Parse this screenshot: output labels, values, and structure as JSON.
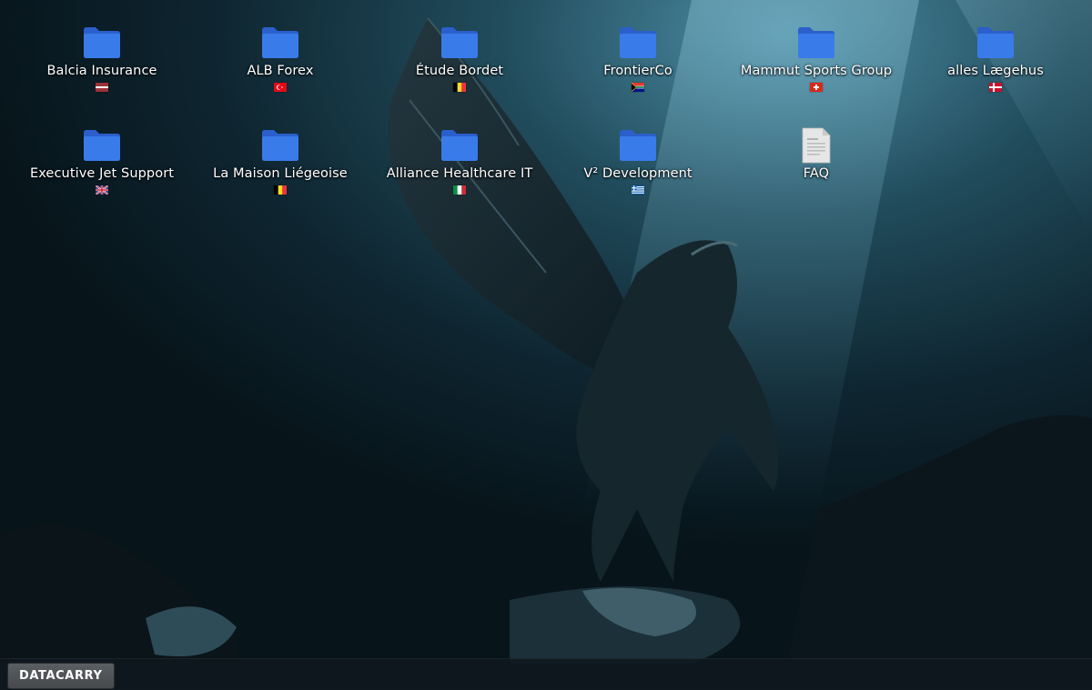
{
  "desktop": {
    "icons": [
      {
        "label": "Balcia Insurance",
        "type": "folder",
        "flag": "latvia-flag-icon"
      },
      {
        "label": "ALB Forex",
        "type": "folder",
        "flag": "turkey-flag-icon"
      },
      {
        "label": "Étude Bordet",
        "type": "folder",
        "flag": "belgium-flag-icon"
      },
      {
        "label": "FrontierCo",
        "type": "folder",
        "flag": "south-africa-flag-icon"
      },
      {
        "label": "Mammut Sports Group",
        "type": "folder",
        "flag": "switzerland-flag-icon"
      },
      {
        "label": "alles Lægehus",
        "type": "folder",
        "flag": "denmark-flag-icon"
      },
      {
        "label": "Executive Jet Support",
        "type": "folder",
        "flag": "united-kingdom-flag-icon"
      },
      {
        "label": "La Maison Liégeoise",
        "type": "folder",
        "flag": "belgium-flag-icon"
      },
      {
        "label": "Alliance Healthcare IT",
        "type": "folder",
        "flag": "italy-flag-icon"
      },
      {
        "label": "V² Development",
        "type": "folder",
        "flag": "greece-flag-icon"
      },
      {
        "label": "FAQ",
        "type": "document",
        "flag": ""
      }
    ]
  },
  "taskbar": {
    "start_label": "DATACARRY"
  },
  "colors": {
    "folder_blue": "#3a7bea",
    "folder_blue_dark": "#2a5fcc",
    "document_gray": "#e6e6e6",
    "taskbar_bg": "#0f181e"
  }
}
